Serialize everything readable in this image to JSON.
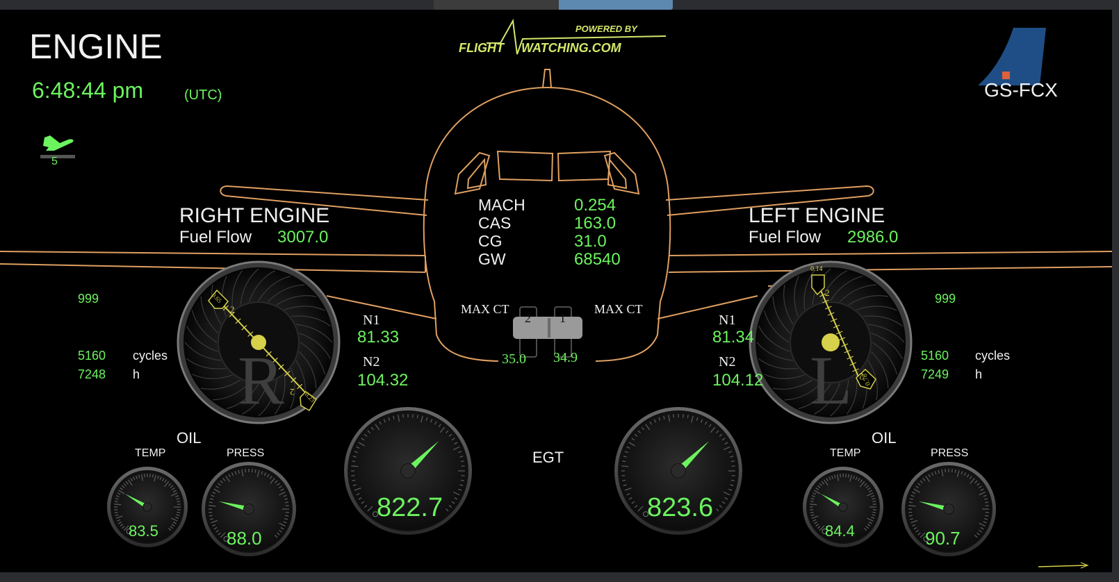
{
  "page": {
    "title": "ENGINE",
    "time": "6:48:44 pm",
    "timezone": "(UTC)",
    "registration": "GS-FCX",
    "flight_phase_icon": "takeoff-icon",
    "flight_phase_value": "5"
  },
  "logo": {
    "powered_by": "POWERED BY",
    "brand_left": "FLIGHT",
    "brand_right": "WATCHING.COM"
  },
  "center": {
    "rows": [
      {
        "label": "MACH",
        "value": "0.254"
      },
      {
        "label": "CAS",
        "value": "163.0"
      },
      {
        "label": "CG",
        "value": "31.0"
      },
      {
        "label": "GW",
        "value": "68540"
      }
    ],
    "max_ct_left": "MAX CT",
    "max_ct_right": "MAX CT",
    "switch_2": "2",
    "switch_1": "1",
    "temp_2": "35.0",
    "temp_1": "34.9"
  },
  "right_engine": {
    "title": "RIGHT ENGINE",
    "fuel_flow_label": "Fuel Flow",
    "fuel_flow": "3007.0",
    "letter": "R",
    "top_value": "999",
    "cycles": "5160",
    "cycles_label": "cycles",
    "hours": "7248",
    "hours_label": "h",
    "n1_label": "N1",
    "n1": "81.33",
    "n2_label": "N2",
    "n2": "104.32",
    "needle_tag_a": "0.65",
    "needle_tag_b": "0.23",
    "needle_mark": "2",
    "oil_label": "OIL",
    "temp_label": "TEMP",
    "press_label": "PRESS",
    "oil_temp": "83.5",
    "oil_press": "88.0",
    "egt": "822.7",
    "oil_temp_fraction": 0.28,
    "oil_press_fraction": 0.22,
    "egt_fraction": 0.67
  },
  "left_engine": {
    "title": "LEFT ENGINE",
    "fuel_flow_label": "Fuel Flow",
    "fuel_flow": "2986.0",
    "letter": "L",
    "top_value": "999",
    "cycles": "5160",
    "cycles_label": "cycles",
    "hours": "7249",
    "hours_label": "h",
    "n1_label": "N1",
    "n1": "81.34",
    "n2_label": "N2",
    "n2": "104.12",
    "needle_tag_a": "0.14",
    "needle_tag_b": "0.78",
    "needle_mark": "2",
    "oil_label": "OIL",
    "temp_label": "TEMP",
    "press_label": "PRESS",
    "oil_temp": "84.4",
    "oil_press": "90.7",
    "egt": "823.6",
    "oil_temp_fraction": 0.28,
    "oil_press_fraction": 0.22,
    "egt_fraction": 0.67
  },
  "egt_label": "EGT",
  "colors": {
    "green": "#6cf45f",
    "outline": "#e0a062",
    "needle_yellow": "#d6d04a",
    "tail_blue": "#1f4e86",
    "tail_orange": "#e0603a"
  }
}
